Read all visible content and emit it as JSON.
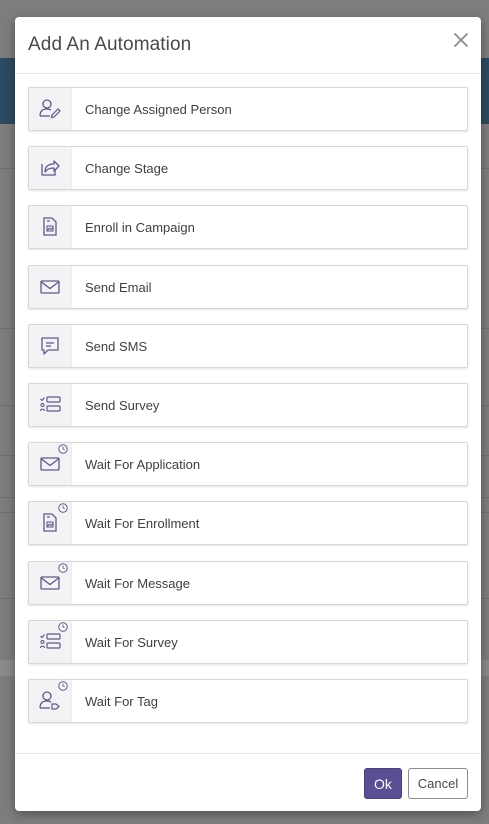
{
  "modal": {
    "title": "Add An Automation",
    "close_icon": "close-icon",
    "accent_color": "#5a4e94"
  },
  "automations": [
    {
      "label": "Change Assigned Person",
      "icon": "user-edit-icon",
      "clock": false
    },
    {
      "label": "Change Stage",
      "icon": "share-arrow-icon",
      "clock": false
    },
    {
      "label": "Enroll in Campaign",
      "icon": "document-image-icon",
      "clock": false
    },
    {
      "label": "Send Email",
      "icon": "envelope-icon",
      "clock": false
    },
    {
      "label": "Send SMS",
      "icon": "chat-message-icon",
      "clock": false
    },
    {
      "label": "Send Survey",
      "icon": "survey-form-icon",
      "clock": false
    },
    {
      "label": "Wait For Application",
      "icon": "envelope-icon",
      "clock": true
    },
    {
      "label": "Wait For Enrollment",
      "icon": "document-image-icon",
      "clock": true
    },
    {
      "label": "Wait For Message",
      "icon": "envelope-icon",
      "clock": true
    },
    {
      "label": "Wait For Survey",
      "icon": "survey-form-icon",
      "clock": true
    },
    {
      "label": "Wait For Tag",
      "icon": "user-tag-icon",
      "clock": true
    }
  ],
  "footer": {
    "ok_label": "Ok",
    "cancel_label": "Cancel"
  }
}
